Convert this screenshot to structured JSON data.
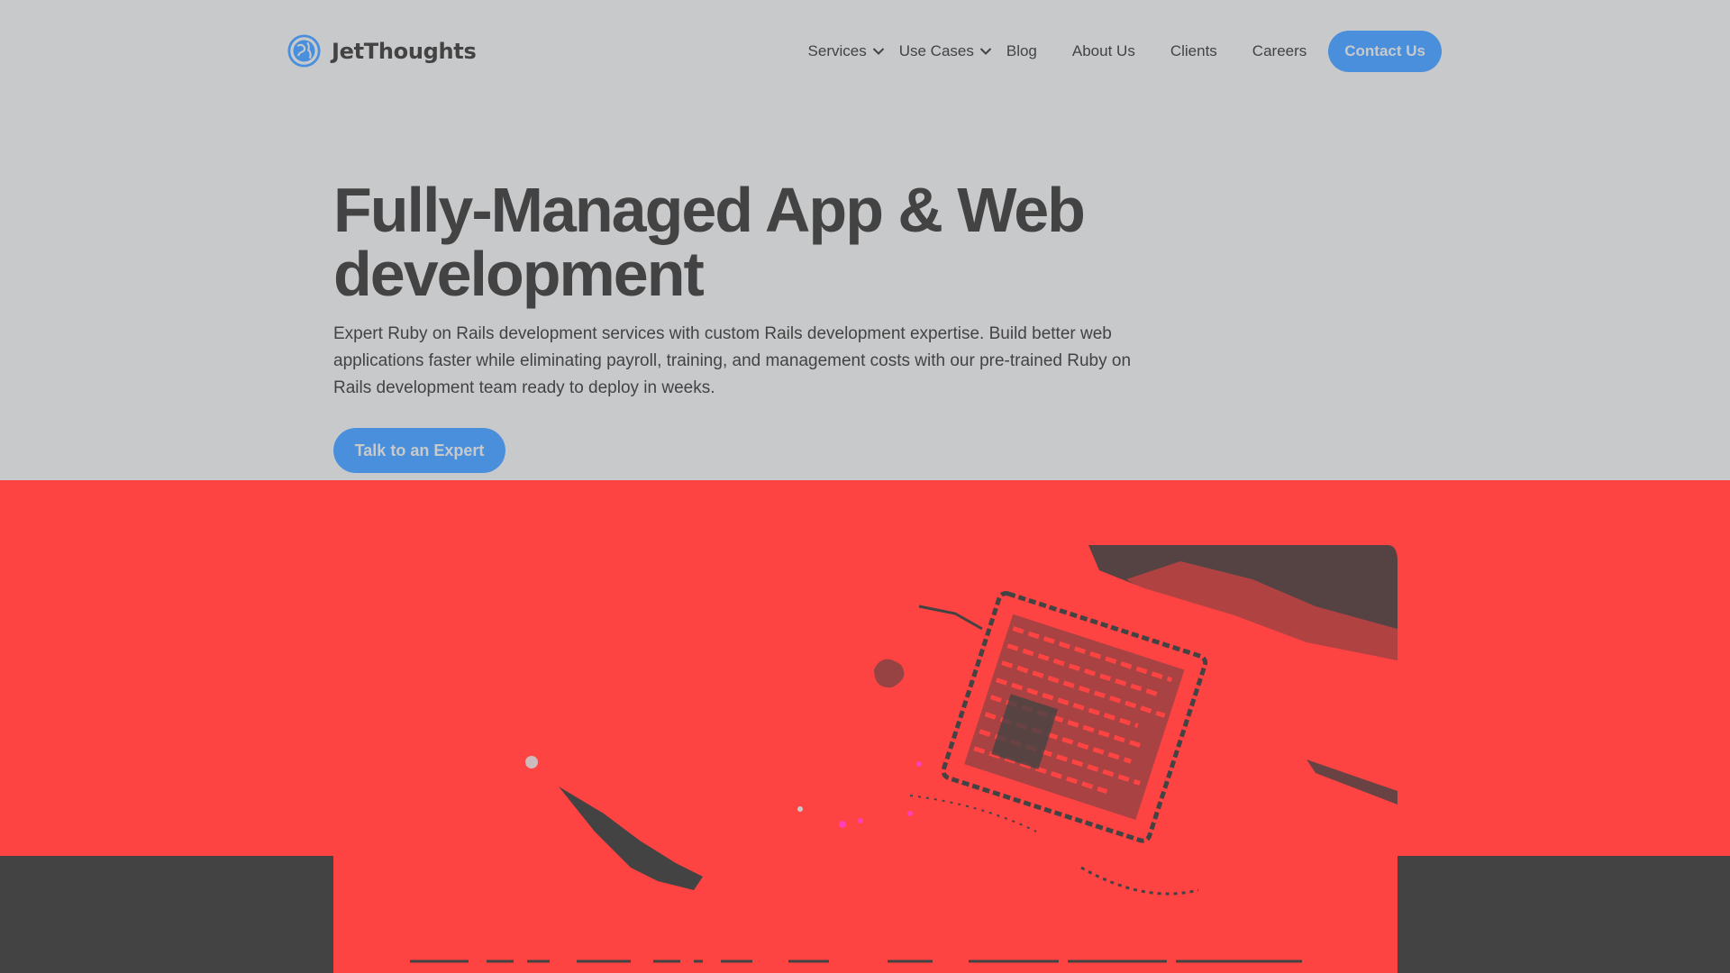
{
  "brand": {
    "name": "JetThoughts",
    "logo_icon": "globe-logo-icon"
  },
  "nav": {
    "services": "Services",
    "use_cases": "Use Cases",
    "blog": "Blog",
    "about": "About Us",
    "clients": "Clients",
    "careers": "Careers",
    "contact": "Contact Us"
  },
  "hero": {
    "title_line1": "Fully-Managed App & Web",
    "title_line2": "development",
    "description": "Expert Ruby on Rails development services with custom Rails development expertise. Build better web applications faster while eliminating payroll, training, and management costs with our pre-trained Ruby on Rails development team ready to deploy in weeks.",
    "cta": "Talk to an Expert"
  },
  "colors": {
    "page_bg": "#c8c9cb",
    "text": "#434343",
    "accent_blue": "#4a8fdb",
    "banner_red": "#fe4343",
    "footer_dark": "#434343"
  }
}
